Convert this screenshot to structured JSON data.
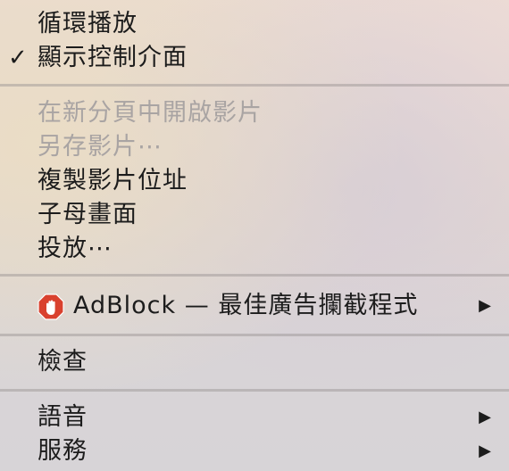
{
  "menu": {
    "loop": {
      "label": "循環播放"
    },
    "show_controls": {
      "label": "顯示控制介面",
      "check": "✓"
    },
    "open_in_new_tab": {
      "label": "在新分頁中開啟影片"
    },
    "save_video_as": {
      "label": "另存影片⋯"
    },
    "copy_video_address": {
      "label": "複製影片位址"
    },
    "picture_in_picture": {
      "label": "子母畫面"
    },
    "cast": {
      "label": "投放⋯"
    },
    "adblock": {
      "label": "AdBlock — 最佳廣告攔截程式",
      "icon": "adblock-hand-icon",
      "arrow": "▶",
      "icon_color": "#d9412e"
    },
    "inspect": {
      "label": "檢查"
    },
    "speech": {
      "label": "語音",
      "arrow": "▶"
    },
    "services": {
      "label": "服務",
      "arrow": "▶"
    }
  }
}
